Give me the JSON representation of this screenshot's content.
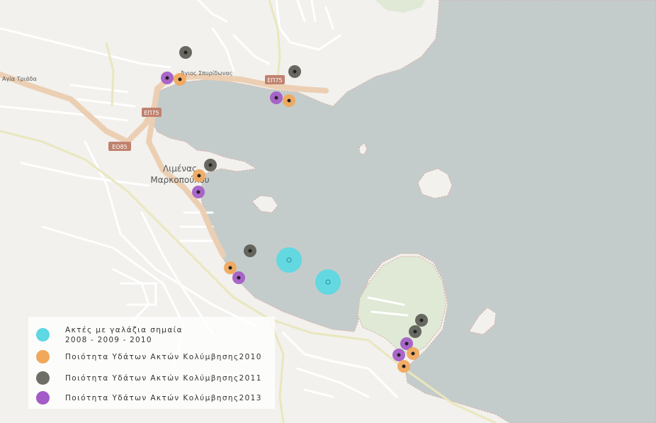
{
  "places": {
    "agia_triada": "Αγία Τριάδα",
    "agios_spyridonas": "Άγιος Σπυρίδωνας",
    "limenas_line1": "Λιμένας",
    "limenas_line2": "Μαρκοπούλου"
  },
  "roads": {
    "ep75_a": "ΕΠ75",
    "ep75_b": "ΕΠ75",
    "eo85": "ΕΟ85"
  },
  "legend": {
    "items": [
      {
        "label": "Ακτές με γαλάζια σημαία",
        "label2": "2008 - 2009 - 2010",
        "color": "#5ed8e2",
        "icon": "blue-flag-beach-marker"
      },
      {
        "label": "Ποιότητα Υδάτων Ακτών Κολύμβησης2010",
        "color": "#f1a75a",
        "icon": "water-quality-2010-marker"
      },
      {
        "label": "Ποιότητα Υδάτων Ακτών Κολύμβησης2011",
        "color": "#6e6e66",
        "icon": "water-quality-2011-marker"
      },
      {
        "label": "Ποιότητα Υδάτων Ακτών Κολύμβησης2013",
        "color": "#a35bc7",
        "icon": "water-quality-2013-marker"
      }
    ]
  },
  "colors": {
    "sea": "#c4cccb",
    "land": "#f2f1ed",
    "park": "#dfe9d6",
    "major_road": "#eccfb3",
    "minor_road": "#ffffff",
    "blue_flag": "#5ed8e2",
    "y2010": "#f1a75a",
    "y2011": "#5c5c55",
    "y2013": "#a35bc7"
  }
}
